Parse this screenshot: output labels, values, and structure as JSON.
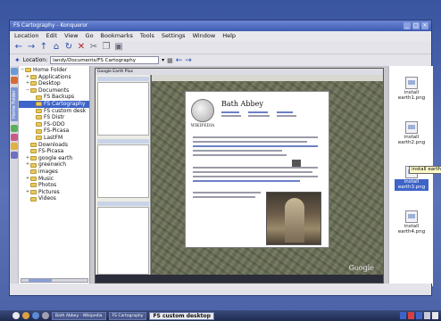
{
  "window": {
    "title": "FS Cartography - Konqueror",
    "controls": [
      "_",
      "□",
      "×"
    ]
  },
  "menubar": [
    "Location",
    "Edit",
    "View",
    "Go",
    "Bookmarks",
    "Tools",
    "Settings",
    "Window",
    "Help"
  ],
  "toolbar": {
    "buttons": [
      {
        "name": "back-icon",
        "glyph": "←"
      },
      {
        "name": "forward-icon",
        "glyph": "→"
      },
      {
        "name": "up-icon",
        "glyph": "↑"
      },
      {
        "name": "home-icon",
        "glyph": "⌂"
      },
      {
        "name": "reload-icon",
        "glyph": "↻"
      },
      {
        "name": "stop-icon",
        "glyph": "✕"
      },
      {
        "name": "cut-icon",
        "glyph": "✂"
      },
      {
        "name": "copy-icon",
        "glyph": "❐"
      },
      {
        "name": "paste-icon",
        "glyph": "▣"
      }
    ]
  },
  "location": {
    "label": "Location:",
    "value": "landy/Documents/FS Cartography"
  },
  "sidebar_tabs": [
    "Home Folder"
  ],
  "tree": [
    {
      "label": "Home Folder",
      "level": 0,
      "exp": "−",
      "sel": false
    },
    {
      "label": "Applications",
      "level": 1,
      "exp": "+",
      "sel": false
    },
    {
      "label": "Desktop",
      "level": 1,
      "exp": "+",
      "sel": false
    },
    {
      "label": "Documents",
      "level": 1,
      "exp": "−",
      "sel": false
    },
    {
      "label": "FS Backups",
      "level": 2,
      "exp": "",
      "sel": false
    },
    {
      "label": "FS Cartography",
      "level": 2,
      "exp": "",
      "sel": true
    },
    {
      "label": "FS custom desk",
      "level": 2,
      "exp": "",
      "sel": false
    },
    {
      "label": "FS Distr",
      "level": 2,
      "exp": "",
      "sel": false
    },
    {
      "label": "FS-ODO",
      "level": 2,
      "exp": "",
      "sel": false
    },
    {
      "label": "FS-Picasa",
      "level": 2,
      "exp": "",
      "sel": false
    },
    {
      "label": "LastFM",
      "level": 2,
      "exp": "",
      "sel": false
    },
    {
      "label": "Downloads",
      "level": 1,
      "exp": "",
      "sel": false
    },
    {
      "label": "FS-Picasa",
      "level": 1,
      "exp": "",
      "sel": false
    },
    {
      "label": "google earth",
      "level": 1,
      "exp": "+",
      "sel": false
    },
    {
      "label": "greenwich",
      "level": 1,
      "exp": "+",
      "sel": false
    },
    {
      "label": "images",
      "level": 1,
      "exp": "",
      "sel": false
    },
    {
      "label": "Music",
      "level": 1,
      "exp": "+",
      "sel": false
    },
    {
      "label": "Photos",
      "level": 1,
      "exp": "",
      "sel": false
    },
    {
      "label": "Pictures",
      "level": 1,
      "exp": "+",
      "sel": false
    },
    {
      "label": "Videos",
      "level": 1,
      "exp": "",
      "sel": false
    }
  ],
  "files": [
    {
      "label": "install earth1.png",
      "sel": false
    },
    {
      "label": "install earth2.png",
      "sel": false
    },
    {
      "label": "install earth3.png",
      "sel": true
    },
    {
      "label": "install earth4.png",
      "sel": false
    }
  ],
  "tooltip": "install earth",
  "preview": {
    "title": "Google Earth Plus",
    "wiki_title": "Bath Abbey",
    "wordmark": "WIKIPEDIA",
    "ge_logo": "Google",
    "status": ""
  },
  "taskbar": {
    "tasks": [
      "Bath Abbey - Wikipedia",
      "FS Cartography"
    ],
    "active": "FS custom desktop"
  }
}
